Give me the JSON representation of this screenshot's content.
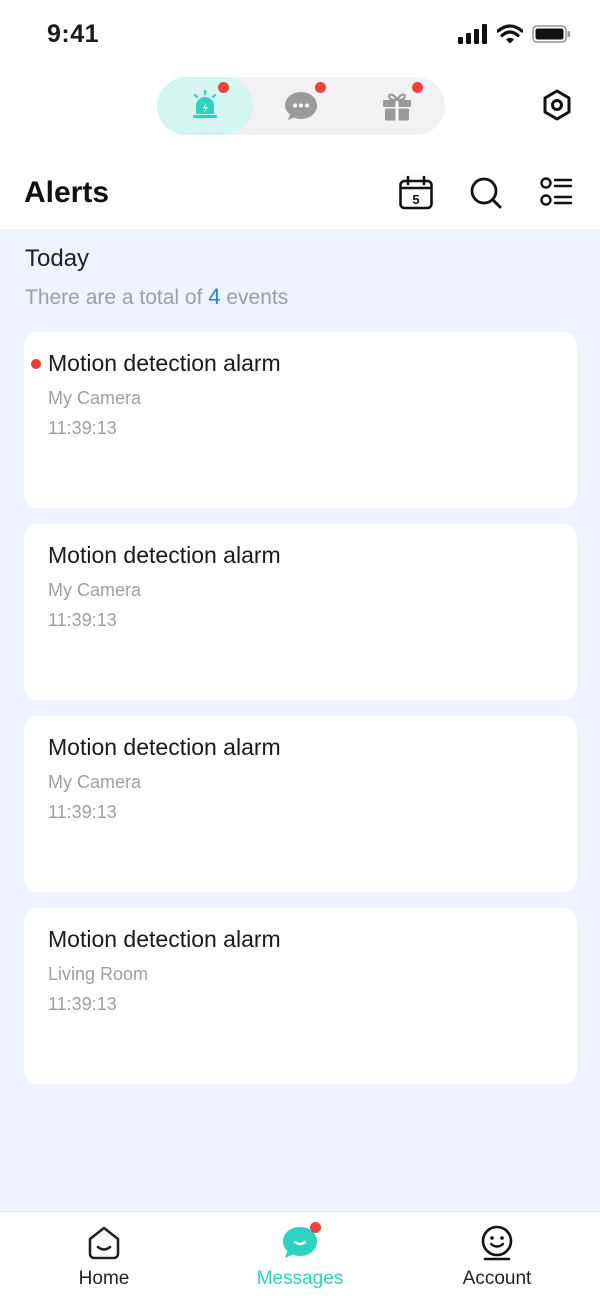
{
  "status_bar": {
    "time": "9:41"
  },
  "segments": [
    {
      "icon": "siren-icon",
      "active": true,
      "badge": true
    },
    {
      "icon": "chat-bubble-icon",
      "active": false,
      "badge": true
    },
    {
      "icon": "gift-icon",
      "active": false,
      "badge": true
    }
  ],
  "header": {
    "title": "Alerts",
    "calendar_day": "5",
    "actions": [
      "calendar-icon",
      "search-icon",
      "list-icon"
    ]
  },
  "section": {
    "heading": "Today",
    "summary_prefix": "There are a total of",
    "summary_count": "4",
    "summary_suffix": "events"
  },
  "alerts": [
    {
      "title": "Motion detection alarm",
      "device": "My Camera",
      "time": "11:39:13",
      "unread": true
    },
    {
      "title": "Motion detection alarm",
      "device": "My Camera",
      "time": "11:39:13",
      "unread": false
    },
    {
      "title": "Motion detection alarm",
      "device": "My Camera",
      "time": "11:39:13",
      "unread": false
    },
    {
      "title": "Motion detection alarm",
      "device": "Living Room",
      "time": "11:39:13",
      "unread": false
    }
  ],
  "tabbar": {
    "items": [
      {
        "label": "Home",
        "icon": "home-icon",
        "active": false
      },
      {
        "label": "Messages",
        "icon": "messages-icon",
        "active": true,
        "badge": true
      },
      {
        "label": "Account",
        "icon": "account-icon",
        "active": false
      }
    ]
  },
  "colors": {
    "accent": "#2fd2c0",
    "badge": "#f04040",
    "link_count": "#2a7de1",
    "content_bg": "#eef3fd"
  }
}
